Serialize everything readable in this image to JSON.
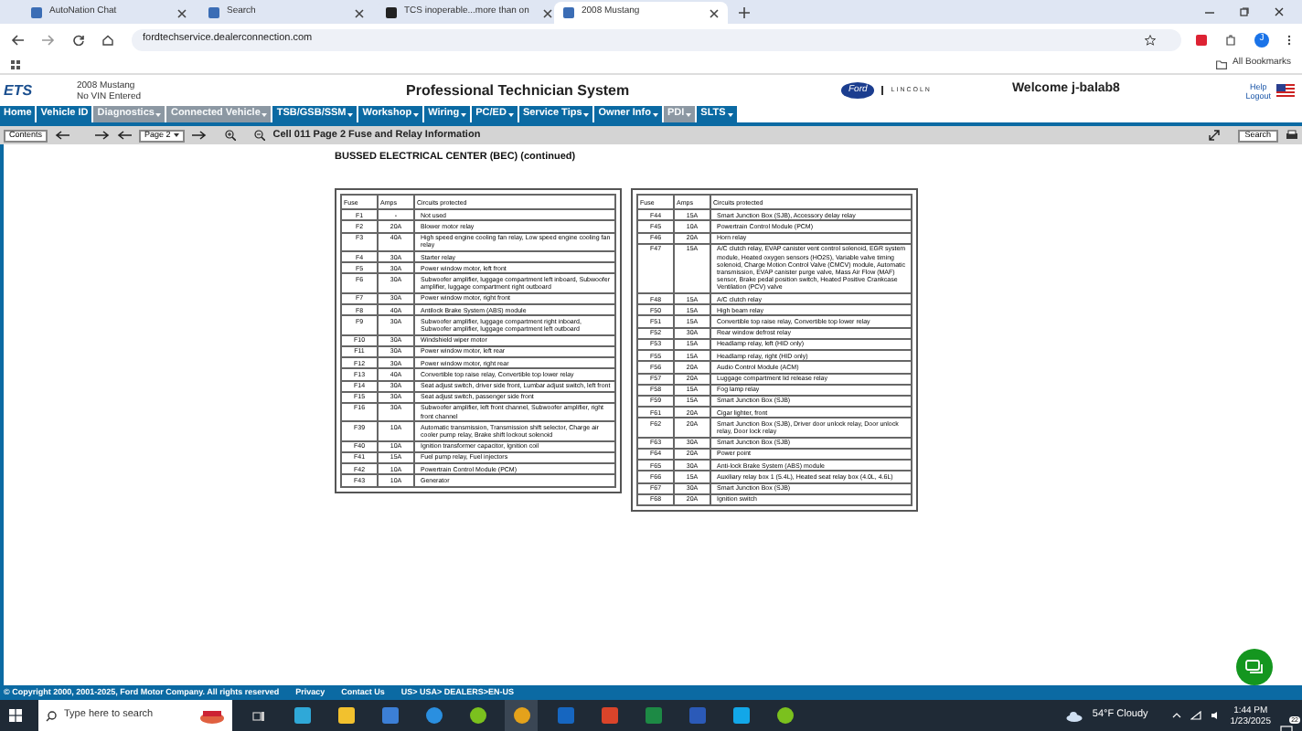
{
  "browser": {
    "tabs": [
      {
        "title": "AutoNation Chat",
        "selected": false
      },
      {
        "title": "Search",
        "selected": false
      },
      {
        "title": "TCS inoperable...more than on",
        "selected": false
      },
      {
        "title": "2008 Mustang",
        "selected": true
      }
    ],
    "url": "fordtechservice.dealerconnection.com",
    "bookmarks": "All Bookmarks",
    "profile": "J"
  },
  "header": {
    "logo": "ETS",
    "vehicle": [
      "2008 Mustang",
      "No VIN Entered"
    ],
    "title": "Professional Technician System",
    "brand_ford": "Ford",
    "brand_lincoln": "LINCOLN",
    "welcome": "Welcome j-balab8",
    "links": [
      "Help",
      "Logout"
    ]
  },
  "nav": [
    {
      "label": "Home",
      "menu": false,
      "disabled": false
    },
    {
      "label": "Vehicle ID",
      "menu": false,
      "disabled": false
    },
    {
      "label": "Diagnostics",
      "menu": true,
      "disabled": true
    },
    {
      "label": "Connected Vehicle",
      "menu": true,
      "disabled": true
    },
    {
      "label": "TSB/GSB/SSM",
      "menu": true,
      "disabled": false
    },
    {
      "label": "Workshop",
      "menu": true,
      "disabled": false
    },
    {
      "label": "Wiring",
      "menu": true,
      "disabled": false
    },
    {
      "label": "PC/ED",
      "menu": true,
      "disabled": false
    },
    {
      "label": "Service Tips",
      "menu": true,
      "disabled": false
    },
    {
      "label": "Owner Info",
      "menu": true,
      "disabled": false
    },
    {
      "label": "PDI",
      "menu": true,
      "disabled": true
    },
    {
      "label": "SLTS",
      "menu": true,
      "disabled": false
    }
  ],
  "toolbar": {
    "contents": "Contents",
    "page": "Page 2",
    "title": "Cell 011 Page 2 Fuse and Relay Information",
    "search": "Search"
  },
  "document": {
    "heading": "BUSSED ELECTRICAL CENTER (BEC) (continued)",
    "tables": [
      {
        "columns": [
          "Fuse",
          "Amps",
          "Circuits protected"
        ],
        "rows": [
          [
            "F1",
            "-",
            "Not used"
          ],
          [
            "F2",
            "20A",
            "Blower motor relay"
          ],
          [
            "F3",
            "40A",
            "High speed engine cooling fan relay, Low speed engine cooling fan relay"
          ],
          [
            "F4",
            "30A",
            "Starter relay"
          ],
          [
            "F5",
            "30A",
            "Power window motor, left front"
          ],
          [
            "F6",
            "30A",
            "Subwoofer amplifier, luggage compartment left inboard, Subwoofer amplifier, luggage compartment right outboard"
          ],
          [
            "F7",
            "30A",
            "Power window motor, right front"
          ],
          [
            "F8",
            "40A",
            "Antilock Brake System (ABS) module"
          ],
          [
            "F9",
            "30A",
            "Subwoofer amplifier, luggage compartment right inboard, Subwoofer amplifier, luggage compartment left outboard"
          ],
          [
            "F10",
            "30A",
            "Windshield wiper motor"
          ],
          [
            "F11",
            "30A",
            "Power window motor, left rear"
          ],
          [
            "F12",
            "30A",
            "Power window motor, right rear"
          ],
          [
            "F13",
            "40A",
            "Convertible top raise relay, Convertible top lower relay"
          ],
          [
            "F14",
            "30A",
            "Seat adjust switch, driver side front, Lumbar adjust switch, left front"
          ],
          [
            "F15",
            "30A",
            "Seat adjust switch, passenger side front"
          ],
          [
            "F16",
            "30A",
            "Subwoofer amplifier, left front channel, Subwoofer amplifier, right front channel"
          ],
          [
            "F39",
            "10A",
            "Automatic transmission, Transmission shift selector, Charge air cooler pump relay, Brake shift lockout solenoid"
          ],
          [
            "F40",
            "10A",
            "Ignition transformer capacitor, Ignition coil"
          ],
          [
            "F41",
            "15A",
            "Fuel pump relay, Fuel injectors"
          ],
          [
            "F42",
            "10A",
            "Powertrain Control Module (PCM)"
          ],
          [
            "F43",
            "10A",
            "Generator"
          ]
        ]
      },
      {
        "columns": [
          "Fuse",
          "Amps",
          "Circuits protected"
        ],
        "rows": [
          [
            "F44",
            "15A",
            "Smart Junction Box (SJB), Accessory delay relay"
          ],
          [
            "F45",
            "10A",
            "Powertrain Control Module (PCM)"
          ],
          [
            "F46",
            "20A",
            "Horn relay"
          ],
          [
            "F47",
            "15A",
            "A/C clutch relay, EVAP canister vent control solenoid, EGR system module, Heated oxygen sensors (HO2S), Variable valve timing solenoid, Charge Motion Control Valve (CMCV) module, Automatic transmission, EVAP canister purge valve, Mass Air Flow (MAF) sensor, Brake pedal position switch, Heated Positive Crankcase Ventilation (PCV) valve"
          ],
          [
            "F48",
            "15A",
            "A/C clutch relay"
          ],
          [
            "F50",
            "15A",
            "High beam relay"
          ],
          [
            "F51",
            "15A",
            "Convertible top raise relay, Convertible top lower relay"
          ],
          [
            "F52",
            "30A",
            "Rear window defrost relay"
          ],
          [
            "F53",
            "15A",
            "Headlamp relay, left (HID only)"
          ],
          [
            "F55",
            "15A",
            "Headlamp relay, right (HID only)"
          ],
          [
            "F56",
            "20A",
            "Audio Control Module (ACM)"
          ],
          [
            "F57",
            "20A",
            "Luggage compartment lid release relay"
          ],
          [
            "F58",
            "15A",
            "Fog lamp relay"
          ],
          [
            "F59",
            "15A",
            "Smart Junction Box (SJB)"
          ],
          [
            "F61",
            "20A",
            "Cigar lighter, front"
          ],
          [
            "F62",
            "20A",
            "Smart Junction Box (SJB), Driver door unlock relay, Door unlock relay, Door lock relay"
          ],
          [
            "F63",
            "30A",
            "Smart Junction Box (SJB)"
          ],
          [
            "F64",
            "20A",
            "Power point"
          ],
          [
            "F65",
            "30A",
            "Anti-lock Brake System (ABS) module"
          ],
          [
            "F66",
            "15A",
            "Auxiliary relay box 1 (5.4L), Heated seat relay box (4.0L, 4.6L)"
          ],
          [
            "F67",
            "30A",
            "Smart Junction Box (SJB)"
          ],
          [
            "F68",
            "20A",
            "Ignition switch"
          ]
        ]
      }
    ]
  },
  "footer": {
    "copyright": "© Copyright 2000, 2001-2025, Ford Motor Company. All rights reserved",
    "links": [
      "Privacy",
      "Contact Us",
      "US> USA> DEALERS>EN-US"
    ]
  },
  "taskbar": {
    "search_placeholder": "Type here to search",
    "weather": "54°F Cloudy",
    "time": "1:44 PM",
    "date": "1/23/2025",
    "notifications": "22"
  }
}
